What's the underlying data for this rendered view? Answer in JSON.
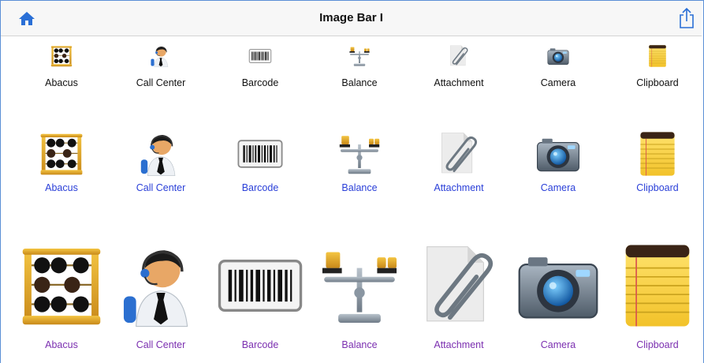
{
  "navbar": {
    "title": "Image Bar I",
    "left_icon": "home-icon",
    "right_icon": "share-icon",
    "accent": "#2a6fd6"
  },
  "rows": [
    {
      "size": "small",
      "label_color": "#111111",
      "items": [
        {
          "label": "Abacus",
          "icon": "abacus-icon"
        },
        {
          "label": "Call Center",
          "icon": "call-center-icon"
        },
        {
          "label": "Barcode",
          "icon": "barcode-icon"
        },
        {
          "label": "Balance",
          "icon": "balance-icon"
        },
        {
          "label": "Attachment",
          "icon": "attachment-icon"
        },
        {
          "label": "Camera",
          "icon": "camera-icon"
        },
        {
          "label": "Clipboard",
          "icon": "clipboard-icon"
        }
      ]
    },
    {
      "size": "medium",
      "label_color": "#2a3fd8",
      "items": [
        {
          "label": "Abacus",
          "icon": "abacus-icon"
        },
        {
          "label": "Call Center",
          "icon": "call-center-icon"
        },
        {
          "label": "Barcode",
          "icon": "barcode-icon"
        },
        {
          "label": "Balance",
          "icon": "balance-icon"
        },
        {
          "label": "Attachment",
          "icon": "attachment-icon"
        },
        {
          "label": "Camera",
          "icon": "camera-icon"
        },
        {
          "label": "Clipboard",
          "icon": "clipboard-icon"
        }
      ]
    },
    {
      "size": "large",
      "label_color": "#7b2fb0",
      "items": [
        {
          "label": "Abacus",
          "icon": "abacus-icon"
        },
        {
          "label": "Call Center",
          "icon": "call-center-icon"
        },
        {
          "label": "Barcode",
          "icon": "barcode-icon"
        },
        {
          "label": "Balance",
          "icon": "balance-icon"
        },
        {
          "label": "Attachment",
          "icon": "attachment-icon"
        },
        {
          "label": "Camera",
          "icon": "camera-icon"
        },
        {
          "label": "Clipboard",
          "icon": "clipboard-icon"
        }
      ]
    }
  ]
}
